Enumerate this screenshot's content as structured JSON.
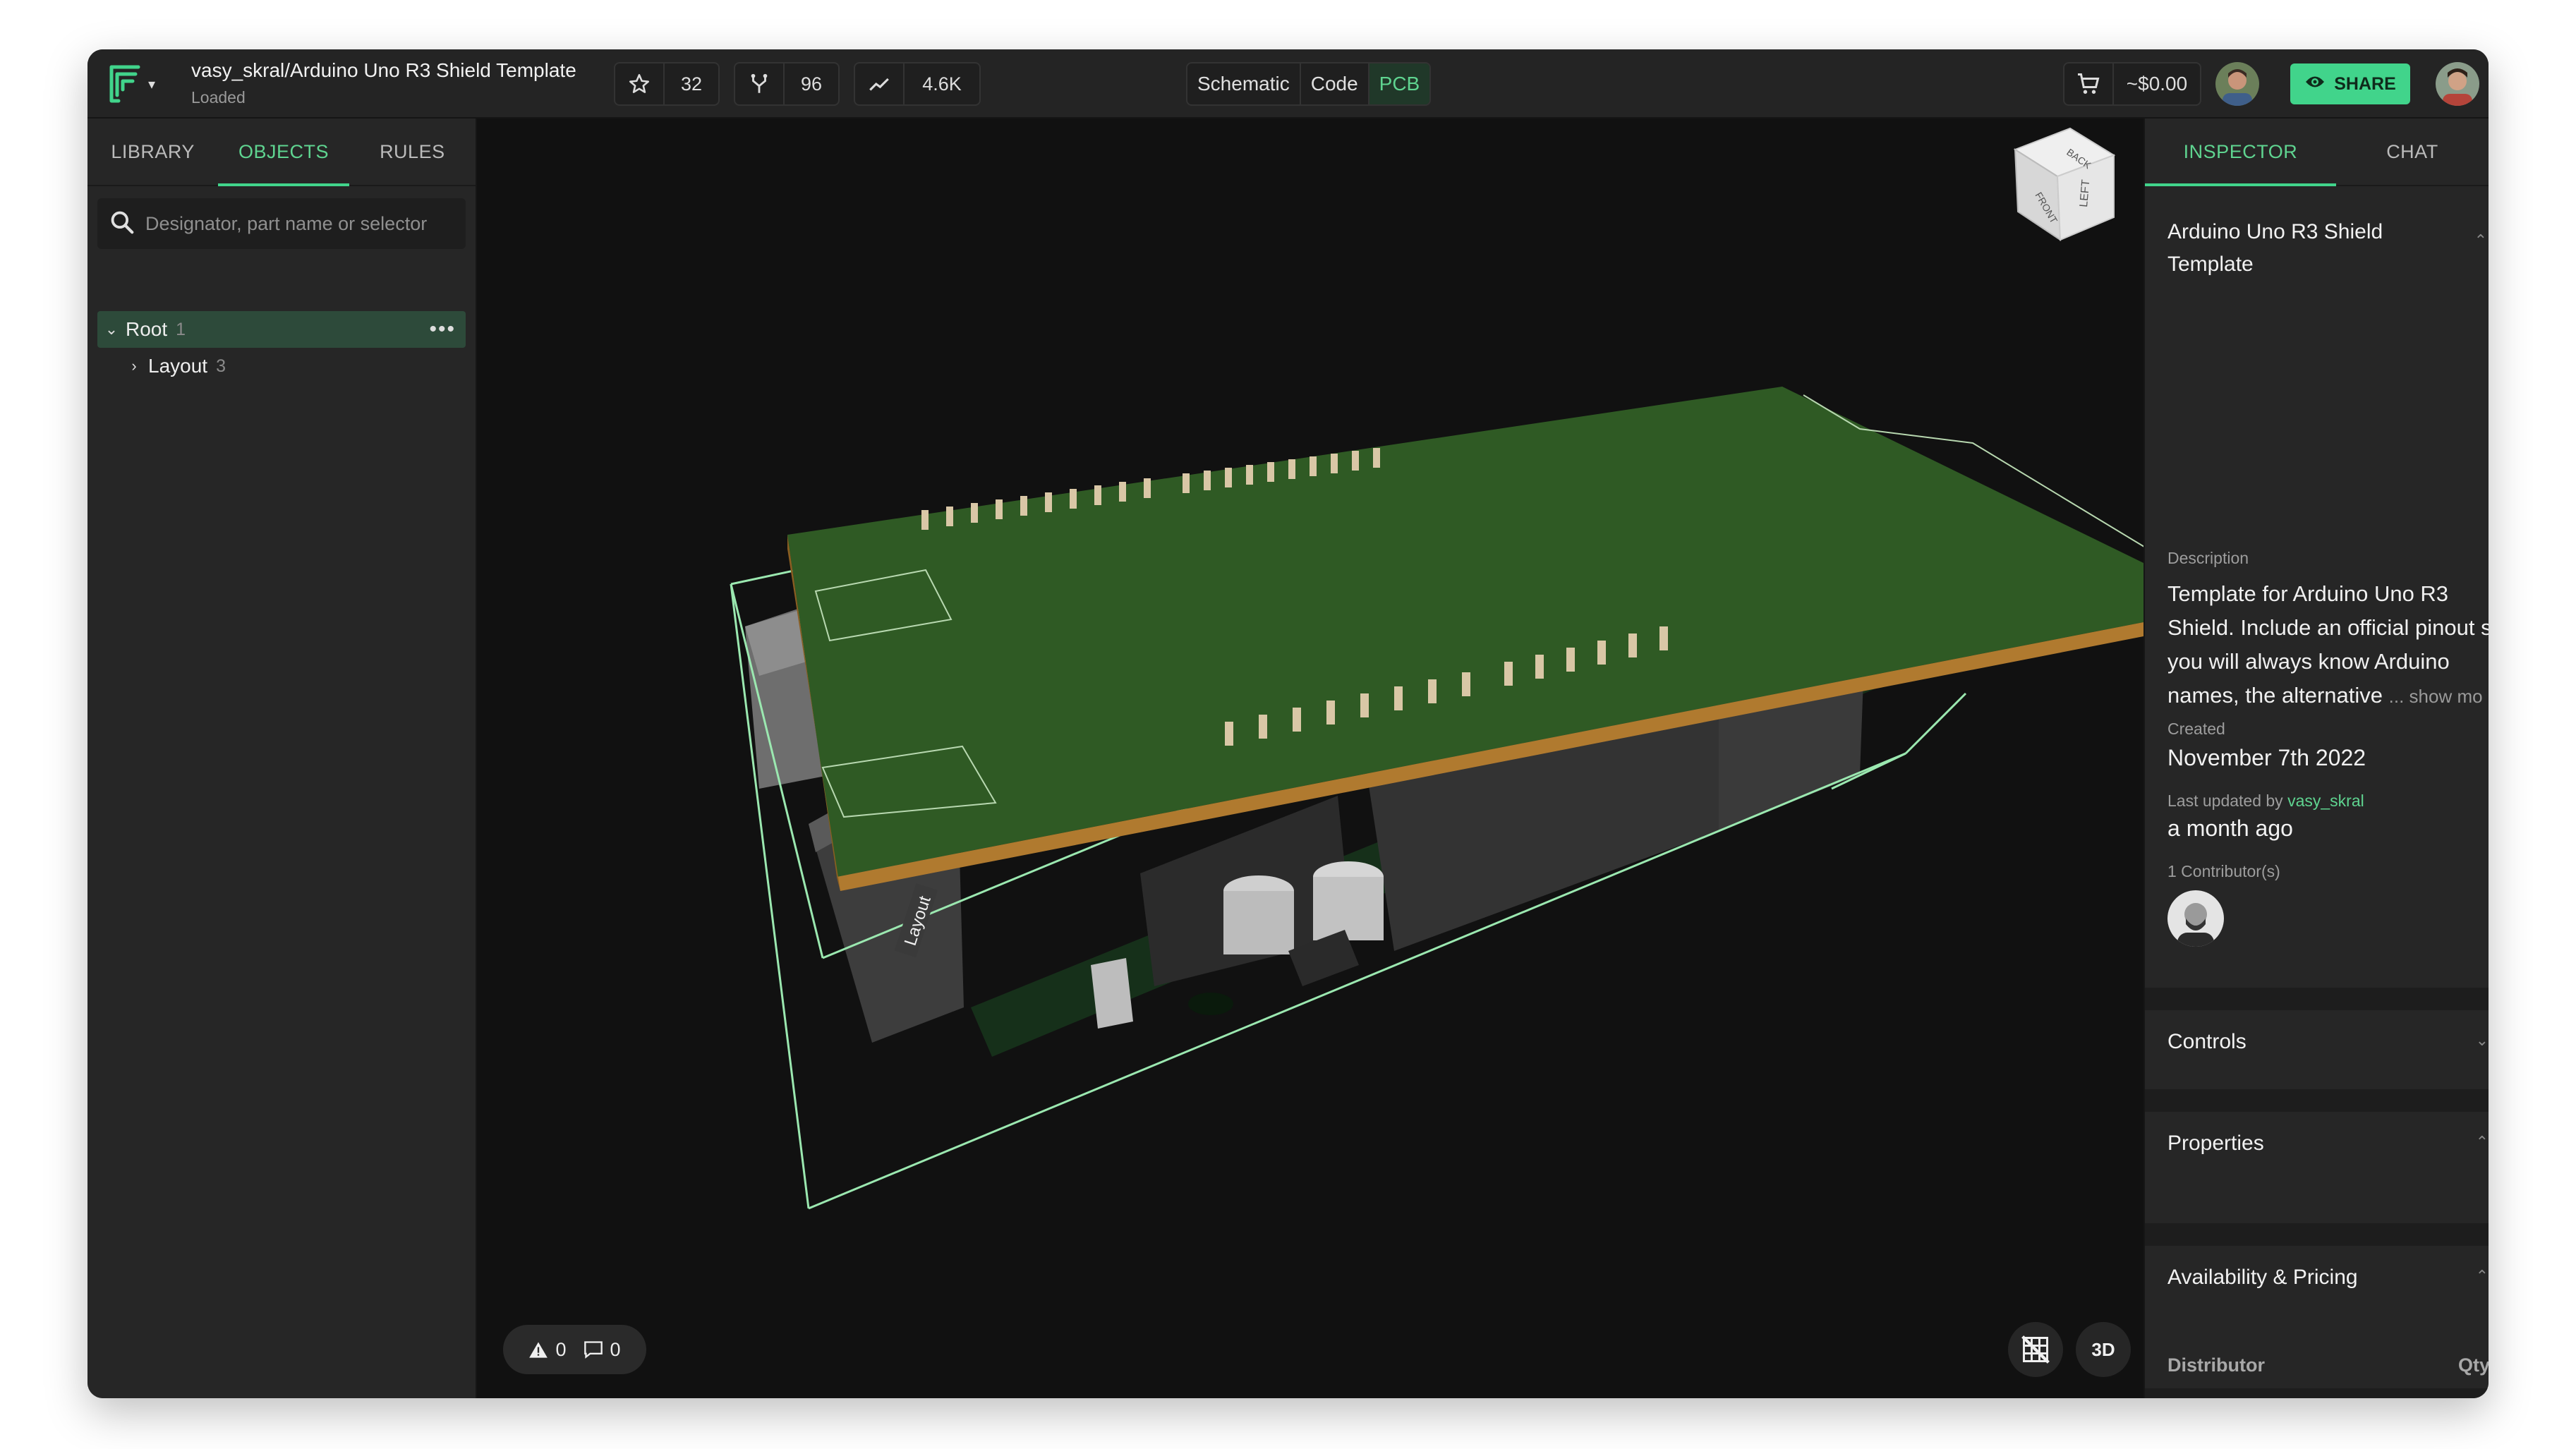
{
  "header": {
    "project_title": "vasy_skral/Arduino Uno R3 Shield Template",
    "project_status": "Loaded",
    "stars": "32",
    "forks": "96",
    "views": "4.6K",
    "modes": [
      "Schematic",
      "Code",
      "PCB"
    ],
    "active_mode": "PCB",
    "cart_price": "~$0.00",
    "share_label": "SHARE"
  },
  "left_panel": {
    "tabs": [
      "LIBRARY",
      "OBJECTS",
      "RULES"
    ],
    "active_tab": "OBJECTS",
    "search_placeholder": "Designator, part name or selector",
    "tree": [
      {
        "label": "Root",
        "count": "1"
      },
      {
        "label": "Layout",
        "count": "3"
      }
    ]
  },
  "viewport": {
    "board_label": "Layout",
    "cube_labels": {
      "top": "BACK",
      "left": "FRONT",
      "right": "LEFT"
    },
    "warnings": "0",
    "comments": "0",
    "view_3d_label": "3D"
  },
  "inspector": {
    "tabs": [
      "INSPECTOR",
      "CHAT"
    ],
    "active_tab": "INSPECTOR",
    "title": "Arduino Uno R3 Shield Template",
    "description_label": "Description",
    "description_lines": [
      "Template for Arduino Uno R3",
      "Shield. Include an official pinout s",
      "you will always know Arduino",
      "names, the alternative"
    ],
    "show_more": "... show mo",
    "created_label": "Created",
    "created_value": "November 7th 2022",
    "updated_label": "Last updated by",
    "updated_by": "vasy_skral",
    "updated_value": "a month ago",
    "contributors": "1 Contributor(s)",
    "sections": [
      "Controls",
      "Properties",
      "Availability & Pricing"
    ],
    "pricing_columns": [
      "Distributor",
      "Qty"
    ]
  },
  "colors": {
    "accent": "#41d48b",
    "board_green": "#2f5a24",
    "board_edge": "#b07a2f",
    "background": "#111111"
  }
}
